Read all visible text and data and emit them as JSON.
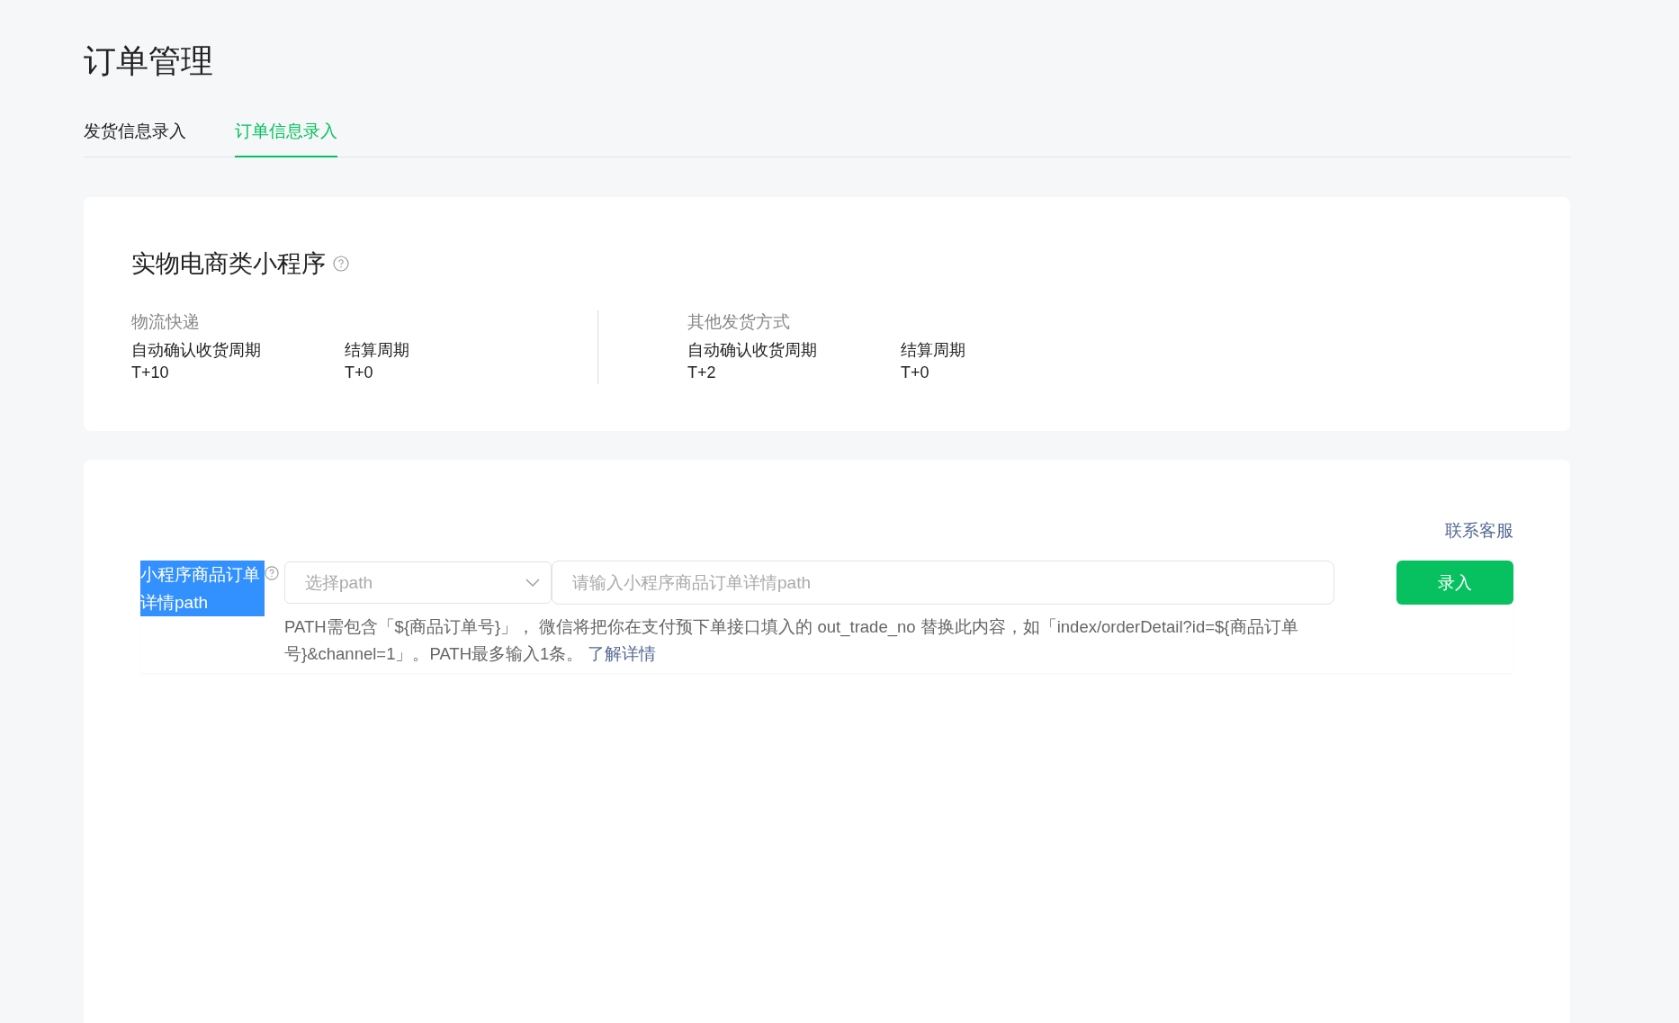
{
  "page_title": "订单管理",
  "tabs": [
    {
      "label": "发货信息录入",
      "selected": false
    },
    {
      "label": "订单信息录入",
      "selected": true
    }
  ],
  "summary_card": {
    "title": "实物电商类小程序",
    "groups": [
      {
        "name": "物流快递",
        "items": [
          {
            "label": "自动确认收货周期",
            "value": "T+10"
          },
          {
            "label": "结算周期",
            "value": "T+0"
          }
        ]
      },
      {
        "name": "其他发货方式",
        "items": [
          {
            "label": "自动确认收货周期",
            "value": "T+2"
          },
          {
            "label": "结算周期",
            "value": "T+0"
          }
        ]
      }
    ]
  },
  "form_card": {
    "contact_link": "联系客服",
    "field_label": "小程序商品订单详情path",
    "select": {
      "placeholder": "选择path"
    },
    "input": {
      "placeholder": "请输入小程序商品订单详情path"
    },
    "submit": "录入",
    "hint": "PATH需包含「${商品订单号}」， 微信将把你在支付预下单接口填入的 out_trade_no 替换此内容，如「index/orderDetail?id=${商品订单号}&channel=1」。PATH最多输入1条。",
    "hint_link": "了解详情"
  }
}
